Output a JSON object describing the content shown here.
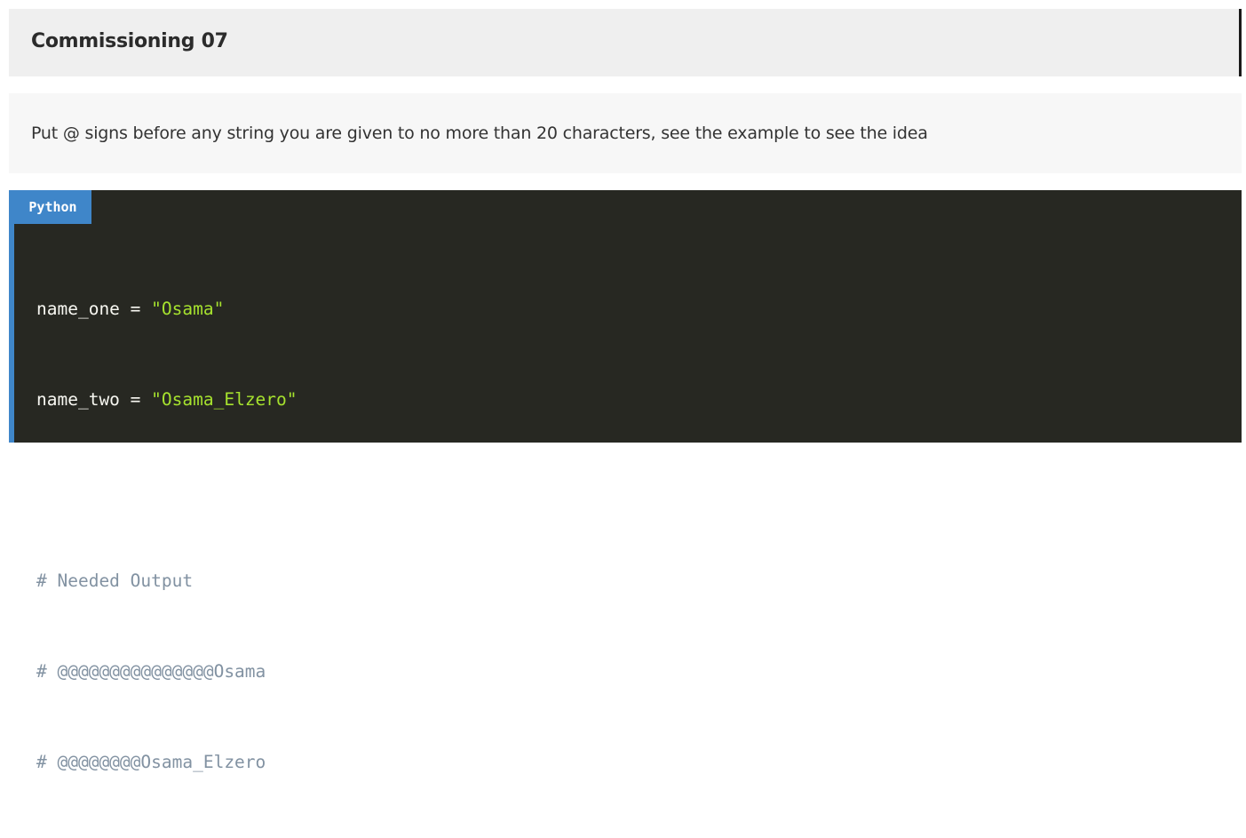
{
  "title": "Commissioning 07",
  "description": "Put @ signs before any string you are given to no more than 20 characters, see the example to see the idea",
  "code_block": {
    "language": "Python",
    "lines": [
      {
        "var": "name_one",
        "op": " = ",
        "str": "\"Osama\""
      },
      {
        "var": "name_two",
        "op": " = ",
        "str": "\"Osama_Elzero\""
      },
      {
        "blank": ""
      },
      {
        "comment": "# Needed Output"
      },
      {
        "comment": "# @@@@@@@@@@@@@@@Osama"
      },
      {
        "comment": "# @@@@@@@@Osama_Elzero"
      }
    ]
  },
  "colors": {
    "accent": "#3f86c9",
    "code_background": "#272822",
    "string": "#a6e22e",
    "comment": "#8292a2",
    "text": "#f8f8f2"
  }
}
